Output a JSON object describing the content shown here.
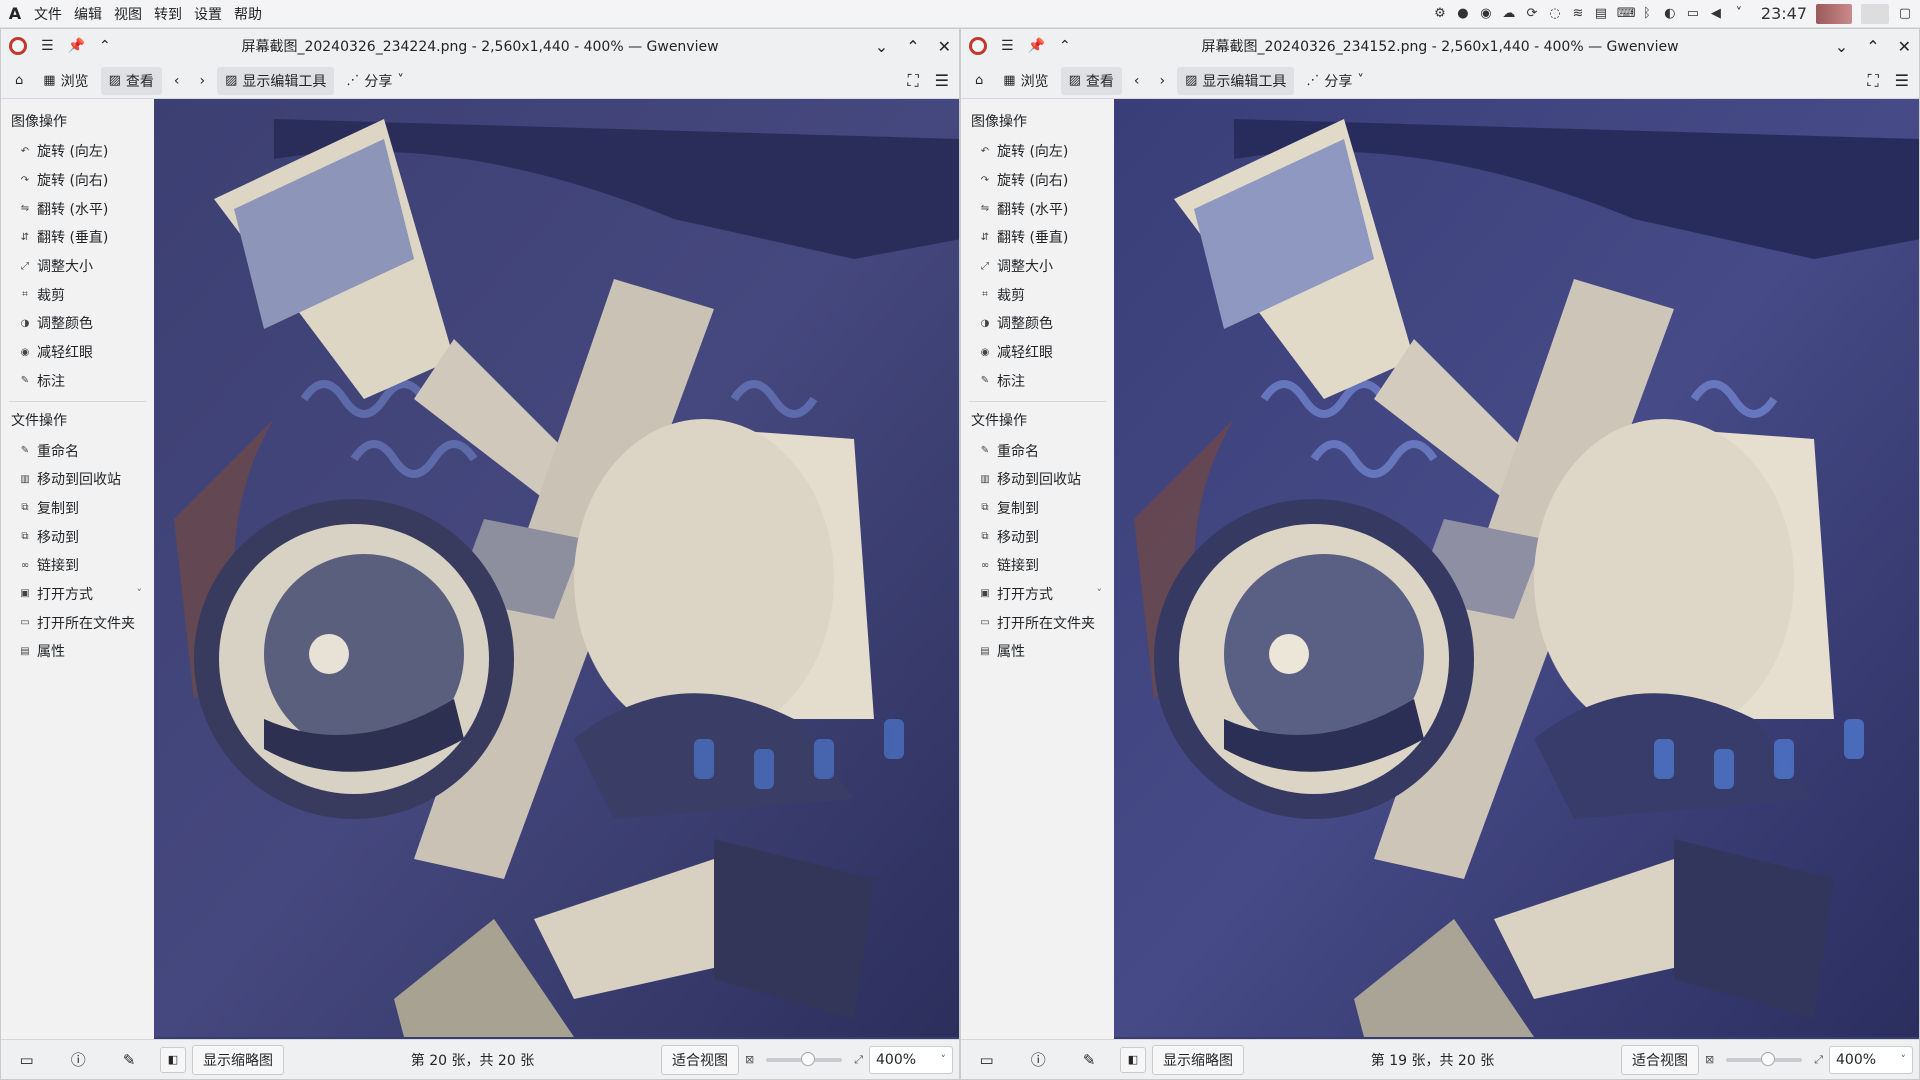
{
  "topbar": {
    "logo": "A",
    "menu": [
      "文件",
      "编辑",
      "视图",
      "转到",
      "设置",
      "帮助"
    ],
    "clock": "23:47"
  },
  "windows": [
    {
      "title": "屏幕截图_20240326_234224.png - 2,560x1,440 - 400% — Gwenview",
      "toolbar": {
        "browse": "浏览",
        "view": "查看",
        "edit_tools": "显示编辑工具",
        "share": "分享"
      },
      "sidebar": {
        "image_ops_title": "图像操作",
        "image_ops": [
          "旋转 (向左)",
          "旋转 (向右)",
          "翻转 (水平)",
          "翻转 (垂直)",
          "调整大小",
          "裁剪",
          "调整颜色",
          "减轻红眼",
          "标注"
        ],
        "file_ops_title": "文件操作",
        "file_ops": [
          "重命名",
          "移动到回收站",
          "复制到",
          "移动到",
          "链接到",
          "打开方式",
          "打开所在文件夹",
          "属性"
        ]
      },
      "status": {
        "thumbnails": "显示缩略图",
        "count": "第 20 张，共 20 张",
        "fit": "适合视图",
        "zoom": "400%",
        "zoom_level": 0.55
      }
    },
    {
      "title": "屏幕截图_20240326_234152.png - 2,560x1,440 - 400% — Gwenview",
      "toolbar": {
        "browse": "浏览",
        "view": "查看",
        "edit_tools": "显示编辑工具",
        "share": "分享"
      },
      "sidebar": {
        "image_ops_title": "图像操作",
        "image_ops": [
          "旋转 (向左)",
          "旋转 (向右)",
          "翻转 (水平)",
          "翻转 (垂直)",
          "调整大小",
          "裁剪",
          "调整颜色",
          "减轻红眼",
          "标注"
        ],
        "file_ops_title": "文件操作",
        "file_ops": [
          "重命名",
          "移动到回收站",
          "复制到",
          "移动到",
          "链接到",
          "打开方式",
          "打开所在文件夹",
          "属性"
        ]
      },
      "status": {
        "thumbnails": "显示缩略图",
        "count": "第 19 张，共 20 张",
        "fit": "适合视图",
        "zoom": "400%",
        "zoom_level": 0.55
      }
    }
  ]
}
